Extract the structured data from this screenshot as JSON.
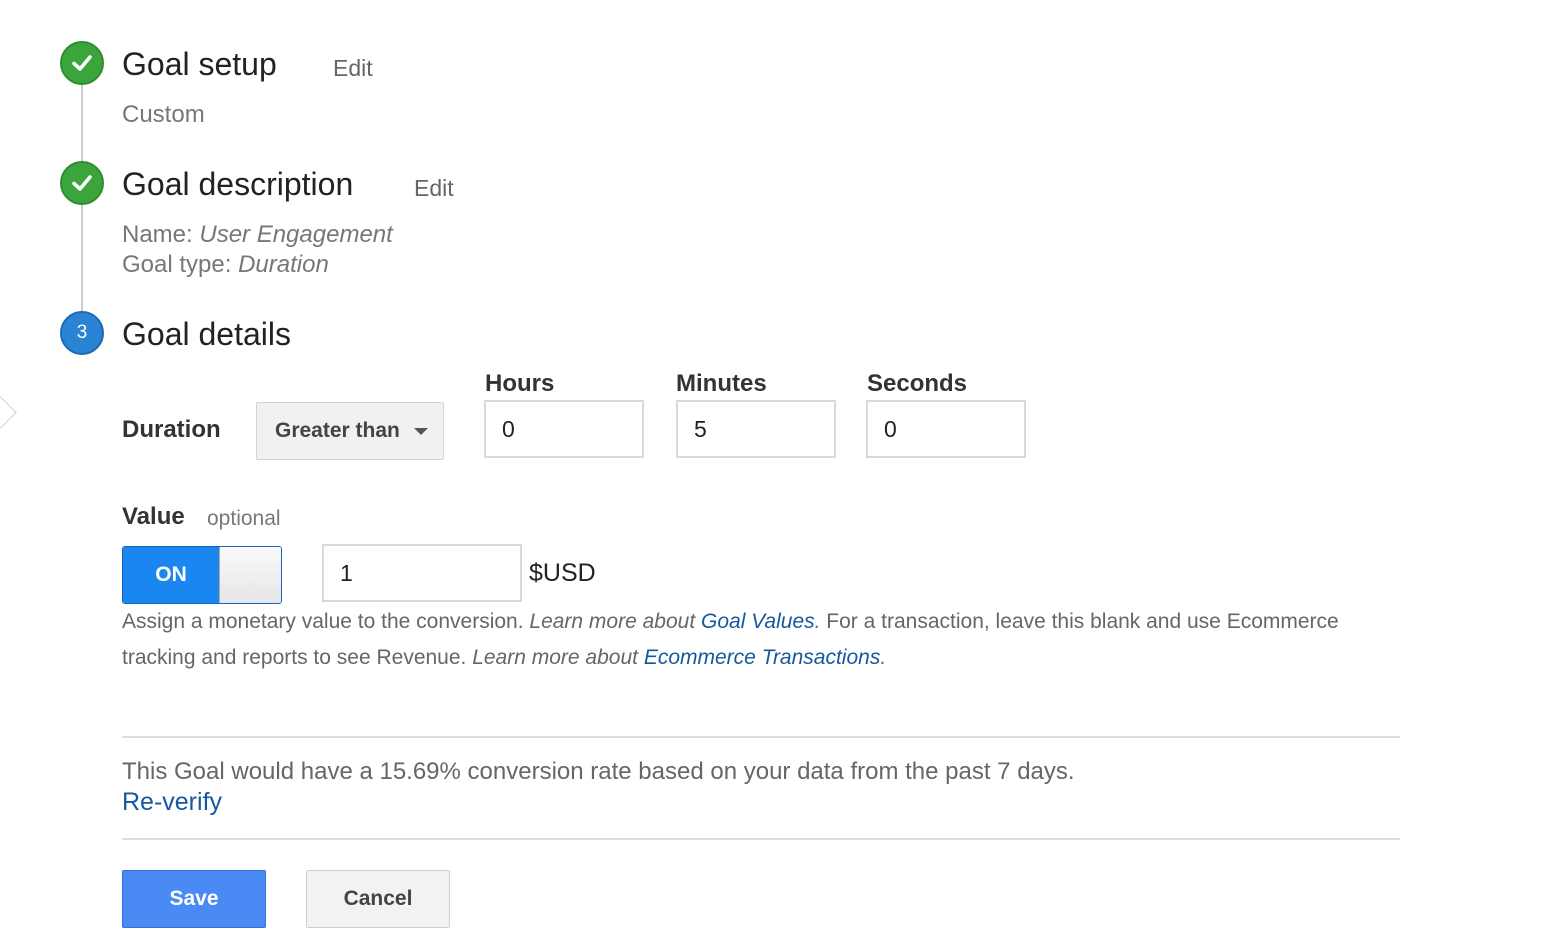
{
  "steps": [
    {
      "title": "Goal setup",
      "edit_label": "Edit",
      "status": "complete",
      "summary": "Custom"
    },
    {
      "title": "Goal description",
      "edit_label": "Edit",
      "status": "complete",
      "name_label": "Name:",
      "name_value": "User Engagement",
      "type_label": "Goal type:",
      "type_value": "Duration"
    },
    {
      "title": "Goal details",
      "status": "current",
      "number": "3"
    }
  ],
  "duration": {
    "label": "Duration",
    "comparison": "Greater than",
    "hours_label": "Hours",
    "hours_value": "0",
    "minutes_label": "Minutes",
    "minutes_value": "5",
    "seconds_label": "Seconds",
    "seconds_value": "0"
  },
  "value": {
    "label": "Value",
    "optional_label": "optional",
    "toggle_label": "ON",
    "toggle_state": "on",
    "amount": "1",
    "currency": "$USD",
    "help": {
      "part1": "Assign a monetary value to the conversion. ",
      "learn1": "Learn more about ",
      "link1": "Goal Values",
      "after_link1": ".",
      "part2": " For a transaction, leave this blank and use Ecommerce tracking and reports to see Revenue. ",
      "learn2": "Learn more about ",
      "link2": "Ecommerce Transactions",
      "after_link2": "."
    }
  },
  "verification": {
    "message": "This Goal would have a 15.69% conversion rate based on your data from the past 7 days.",
    "reverify_label": "Re-verify"
  },
  "actions": {
    "save_label": "Save",
    "cancel_label": "Cancel"
  },
  "colors": {
    "complete_green": "#3aa53a",
    "current_blue": "#2b83d4",
    "toggle_blue": "#1a86f0",
    "save_blue": "#4a8af4",
    "link_blue": "#15589e"
  }
}
